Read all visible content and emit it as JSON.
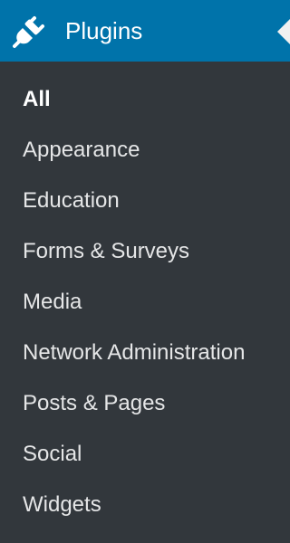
{
  "header": {
    "title": "Plugins",
    "icon": "plugin-icon"
  },
  "submenu": {
    "items": [
      {
        "label": "All",
        "current": true
      },
      {
        "label": "Appearance"
      },
      {
        "label": "Education"
      },
      {
        "label": "Forms & Surveys"
      },
      {
        "label": "Media"
      },
      {
        "label": "Network Administration"
      },
      {
        "label": "Posts & Pages"
      },
      {
        "label": "Social"
      },
      {
        "label": "Widgets"
      }
    ]
  },
  "colors": {
    "header_bg": "#0073aa",
    "menu_bg": "#32373c",
    "text": "#e5e6e7",
    "current_text": "#ffffff"
  }
}
